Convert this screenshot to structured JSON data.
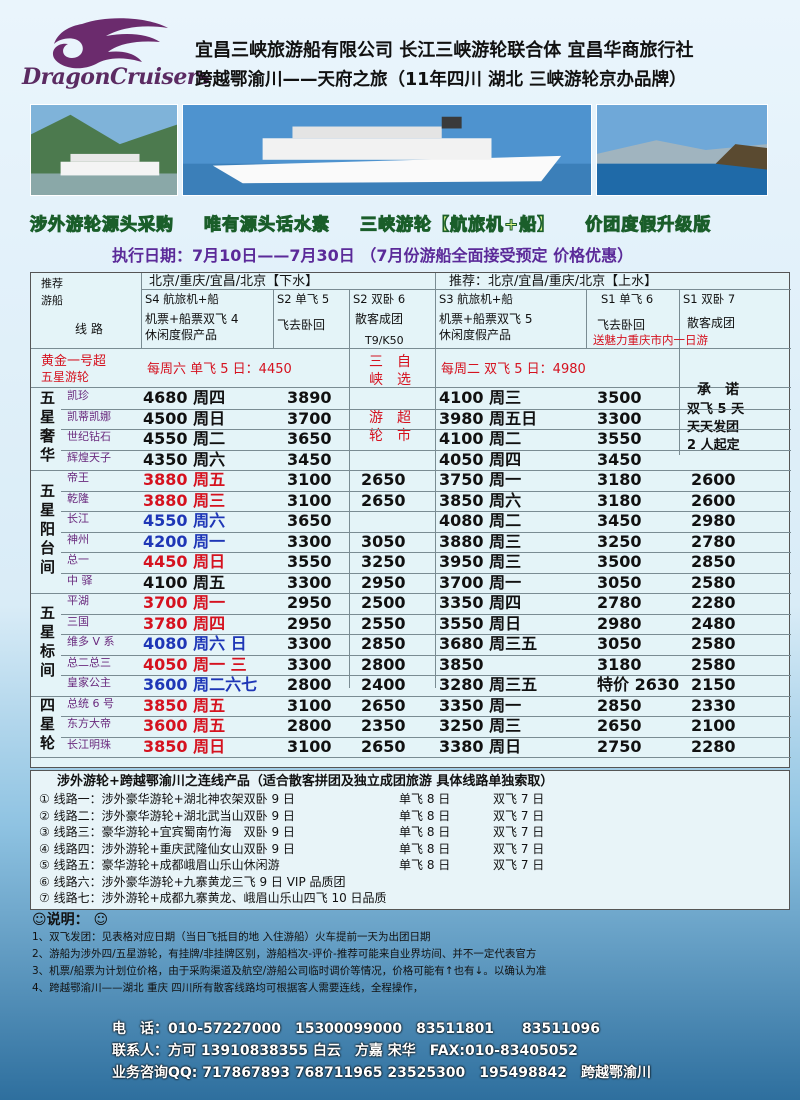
{
  "header": {
    "logo_text": "DragonCruisers",
    "line1": "宜昌三峡旅游船有限公司 长江三峡游轮联合体 宜昌华商旅行社",
    "line2": "跨越鄂渝川——天府之旅（11年四川 湖北 三峡游轮京办品牌）"
  },
  "slogan": [
    "涉外游轮源头采购",
    "唯有源头话水素",
    "三峡游轮【航旅机+船】",
    "价团度假升级版"
  ],
  "exec_date": "执行日期：7月10日——7月30日 （7月份游船全面接受预定 价格优惠）",
  "table": {
    "corner_top": "推荐",
    "corner_bot": "游船",
    "route_label": "线 路",
    "down_title": "北京/重庆/宜昌/北京【下水】",
    "up_title": "推荐：北京/宜昌/重庆/北京【上水】",
    "s4": "S4 航旅机+船",
    "s2a": "S2 单飞 5",
    "s2b": "S2 双卧 6",
    "s3": "S3 航旅机+船",
    "s1a": "S1 单飞 6",
    "s1b": "S1 双卧 7",
    "s4d": "机票+船票双飞 4",
    "s4d2": "休闲度假产品",
    "s2ad": "飞去卧回",
    "s2bd": "散客成团",
    "s2bt": "T9/K50",
    "s3d": "机票+船票双飞 5",
    "s3d2": "休闲度假产品",
    "s1ad": "飞去卧回",
    "s1bd": "散客成团",
    "s1bn": "送魅力重庆市内一日游",
    "gold1": "黄金一号超",
    "gold2": "五星游轮",
    "gold_down": "每周六 单飞 5 日：4450",
    "gold_up": "每周二 双飞 5 日：4980",
    "sx1": "三　自",
    "sx2": "峡　选",
    "sx3": "游　超",
    "sx4": "轮　市",
    "promise": "承　诺",
    "p1": "双飞 5 天",
    "p2": "天天发团",
    "p3": "2 人起定",
    "cat1": [
      "五",
      "星",
      "奢",
      "华"
    ],
    "cat2": [
      "五",
      "星",
      "阳",
      "台",
      "间"
    ],
    "cat3": [
      "五",
      "星",
      "标",
      "间"
    ],
    "cat4": [
      "四",
      "星",
      "轮"
    ],
    "rows": [
      {
        "n": "凯珍",
        "a": "4680 周四",
        "b": "3890",
        "c": "",
        "d": "4100 周三",
        "e": "3500",
        "f": ""
      },
      {
        "n": "凯蒂凯娜",
        "a": "4500 周日",
        "b": "3700",
        "c": "",
        "d": "3980 周五日",
        "e": "3300",
        "f": ""
      },
      {
        "n": "世纪钻石",
        "a": "4550 周二",
        "b": "3650",
        "c": "",
        "d": "4100 周二",
        "e": "3550",
        "f": ""
      },
      {
        "n": "辉煌天子",
        "a": "4350 周六",
        "b": "3450",
        "c": "",
        "d": "4050 周四",
        "e": "3450",
        "f": ""
      },
      {
        "n": "帝王",
        "a": "3880 周五",
        "b": "3100",
        "c": "2650",
        "d": "3750 周一",
        "e": "3180",
        "f": "2600"
      },
      {
        "n": "乾隆",
        "a": "3880 周三",
        "b": "3100",
        "c": "2650",
        "d": "3850 周六",
        "e": "3180",
        "f": "2600"
      },
      {
        "n": "长江",
        "a": "4550 周六",
        "b": "3650",
        "c": "",
        "d": "4080 周二",
        "e": "3450",
        "f": "2980"
      },
      {
        "n": "神州",
        "a": "4200 周一",
        "b": "3300",
        "c": "3050",
        "d": "3880 周三",
        "e": "3250",
        "f": "2780"
      },
      {
        "n": "总一",
        "a": "4450 周日",
        "b": "3550",
        "c": "3250",
        "d": "3950 周三",
        "e": "3500",
        "f": "2850"
      },
      {
        "n": "中 驿",
        "a": "4100 周五",
        "b": "3300",
        "c": "2950",
        "d": "3700 周一",
        "e": "3050",
        "f": "2580"
      },
      {
        "n": "平湖",
        "a": "3700 周一",
        "b": "2950",
        "c": "2500",
        "d": "3350 周四",
        "e": "2780",
        "f": "2280"
      },
      {
        "n": "三国",
        "a": "3780 周四",
        "b": "2950",
        "c": "2550",
        "d": "3550 周日",
        "e": "2980",
        "f": "2480"
      },
      {
        "n": "维多 V 系",
        "a": "4080 周六 日",
        "b": "3300",
        "c": "2850",
        "d": "3680 周三五",
        "e": "3050",
        "f": "2580"
      },
      {
        "n": "总二总三",
        "a": "4050 周一 三",
        "b": "3300",
        "c": "2800",
        "d": "3850",
        "e": "3180",
        "f": "2580"
      },
      {
        "n": "皇家公主",
        "a": "3600 周二六七",
        "b": "2800",
        "c": "2400",
        "d": "3280 周三五",
        "e": "特价 2630",
        "f": "2150"
      },
      {
        "n": "总统 6 号",
        "a": "3850 周五",
        "b": "3100",
        "c": "2650",
        "d": "3350 周一",
        "e": "2850",
        "f": "2330"
      },
      {
        "n": "东方大帝",
        "a": "3600 周五",
        "b": "2800",
        "c": "2350",
        "d": "3250 周三",
        "e": "2650",
        "f": "2100"
      },
      {
        "n": "长江明珠",
        "a": "3850 周日",
        "b": "3100",
        "c": "2650",
        "d": "3380 周日",
        "e": "2750",
        "f": "2280"
      }
    ]
  },
  "lines": {
    "title": "涉外游轮+跨越鄂渝川之连线产品（适合散客拼团及独立成团旅游 具体线路单独索取）",
    "items": [
      {
        "a": "① 线路一：涉外豪华游轮+湖北神农架双卧 9 日",
        "b": "单飞 8 日",
        "c": "双飞 7 日"
      },
      {
        "a": "② 线路二：涉外豪华游轮+湖北武当山双卧 9 日",
        "b": "单飞 8 日",
        "c": "双飞 7 日"
      },
      {
        "a": "③ 线路三：豪华游轮+宜宾蜀南竹海　双卧 9 日",
        "b": "单飞 8 日",
        "c": "双飞 7 日"
      },
      {
        "a": "④ 线路四：涉外游轮+重庆武隆仙女山双卧 9 日",
        "b": "单飞 8 日",
        "c": "双飞 7 日"
      },
      {
        "a": "⑤ 线路五：豪华游轮+成都峨眉山乐山休闲游",
        "b": "单飞 8 日",
        "c": "双飞 7 日"
      },
      {
        "a": "⑥ 线路六：涉外豪华游轮+九寨黄龙三飞 9 日 VIP 品质团",
        "b": "",
        "c": ""
      },
      {
        "a": "⑦ 线路七：涉外游轮+成都九寨黄龙、峨眉山乐山四飞 10 日品质",
        "b": "",
        "c": ""
      }
    ]
  },
  "notes": {
    "title": "说明：",
    "items": [
      "1、双飞发团：见表格对应日期（当日飞抵目的地 入住游船）火车提前一天为出团日期",
      "2、游船为涉外四/五星游轮，有挂牌/非挂牌区别，游船档次-评价-推荐可能来自业界坊间、并不一定代表官方",
      "3、机票/船票为计划位价格，由于采购渠道及航空/游船公司临时调价等情况，价格可能有↑也有↓。以确认为准",
      "4、跨越鄂渝川——湖北 重庆 四川所有散客线路均可根据客人需要连线，全程操作，"
    ]
  },
  "contact": {
    "phone": "电　话：010-57227000　15300099000　83511801　　83511096",
    "people": "联系人：方可 13910838355 白云　方嘉 宋华　FAX:010-83405052",
    "qq": "业务咨询QQ: 717867893 768711965 23525300　195498842　跨越鄂渝川"
  },
  "colors": {
    "red": "#d5121f",
    "blue": "#1e36b6",
    "purple": "#6a2a7e"
  }
}
